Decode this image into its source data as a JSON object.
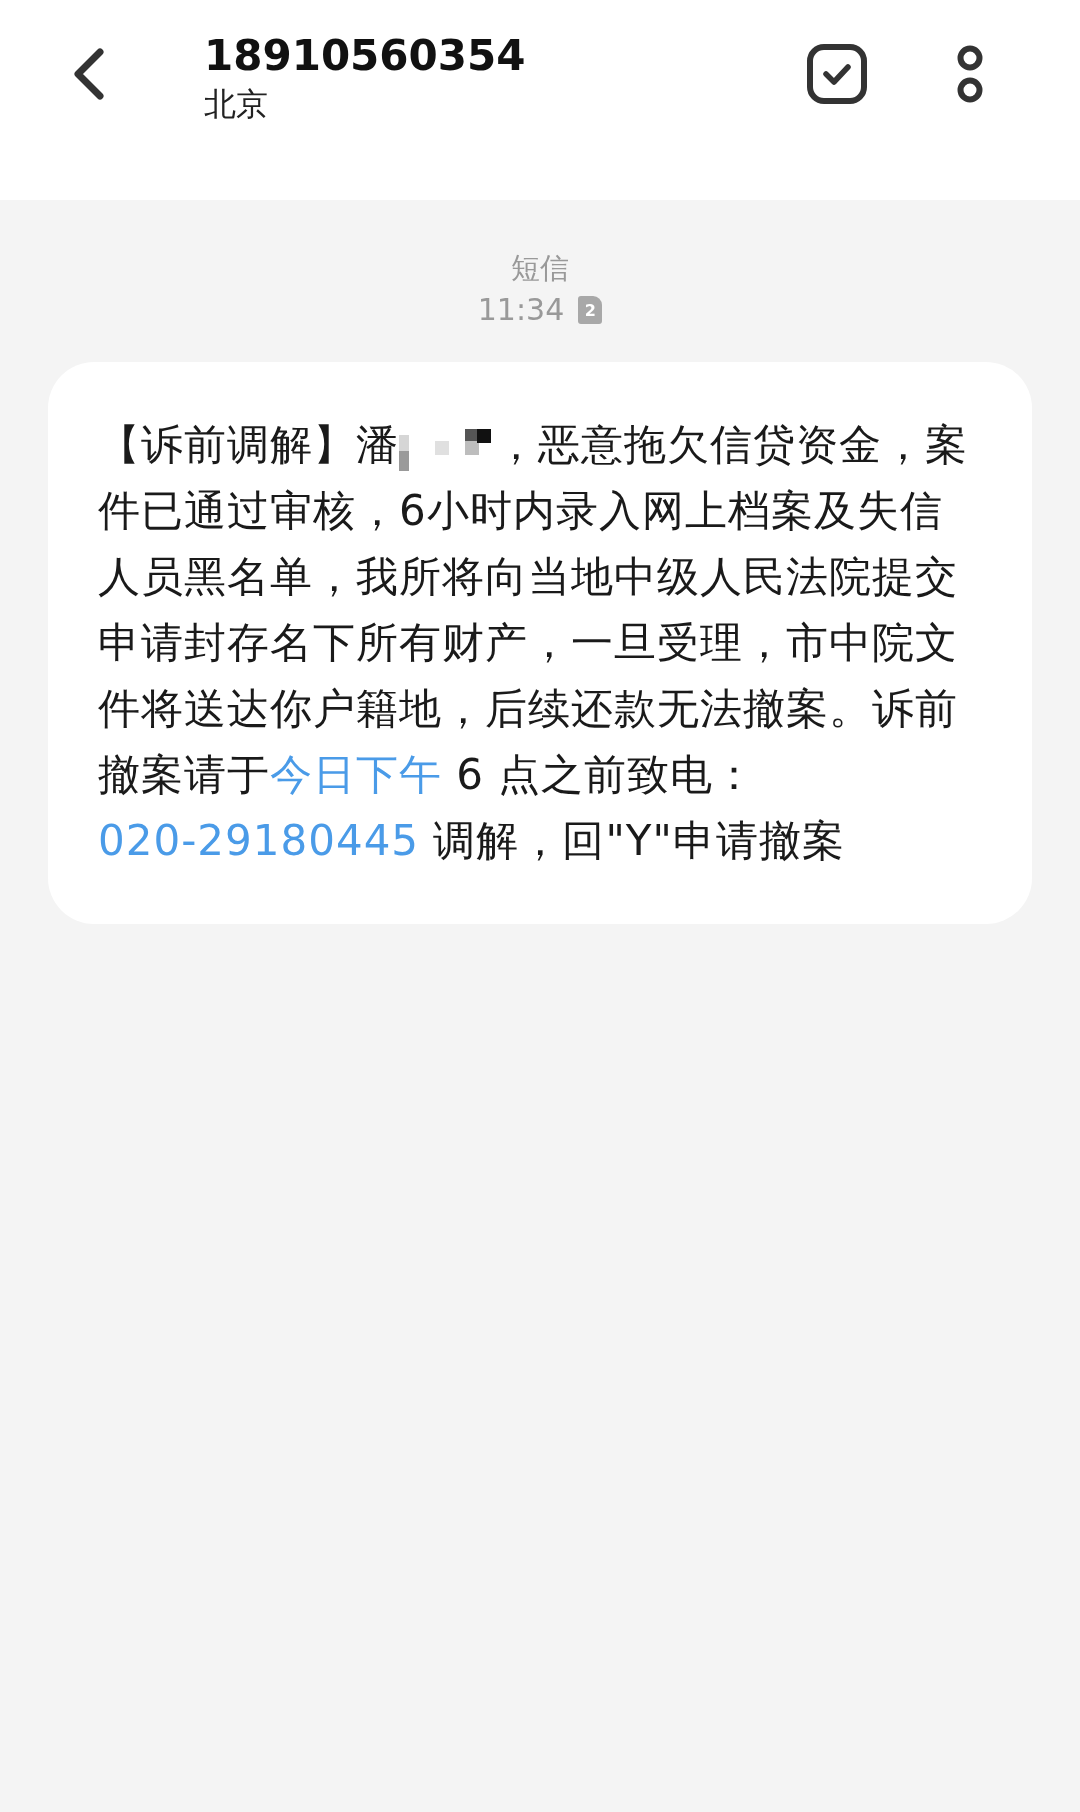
{
  "header": {
    "title": "18910560354",
    "subtitle": "北京"
  },
  "message_meta": {
    "channel": "短信",
    "time": "11:34",
    "sim": "2"
  },
  "message": {
    "segments": [
      {
        "kind": "text",
        "text": "【诉前调解】潘"
      },
      {
        "kind": "redacted"
      },
      {
        "kind": "text",
        "text": "，恶意拖欠信贷资金，案件已通过审核，6小时内录入网上档案及失信人员黑名单，我所将向当地中级人民法院提交申请封存名下所有财产，一旦受理，市中院文件将送达你户籍地，后续还款无法撤案。诉前撤案请于"
      },
      {
        "kind": "link",
        "text": "今日下午"
      },
      {
        "kind": "text",
        "text": " 6 点之前致电："
      },
      {
        "kind": "link",
        "text": "020-29180445"
      },
      {
        "kind": "text",
        "text": " 调解，回\"Y\"申请撤案"
      }
    ]
  }
}
